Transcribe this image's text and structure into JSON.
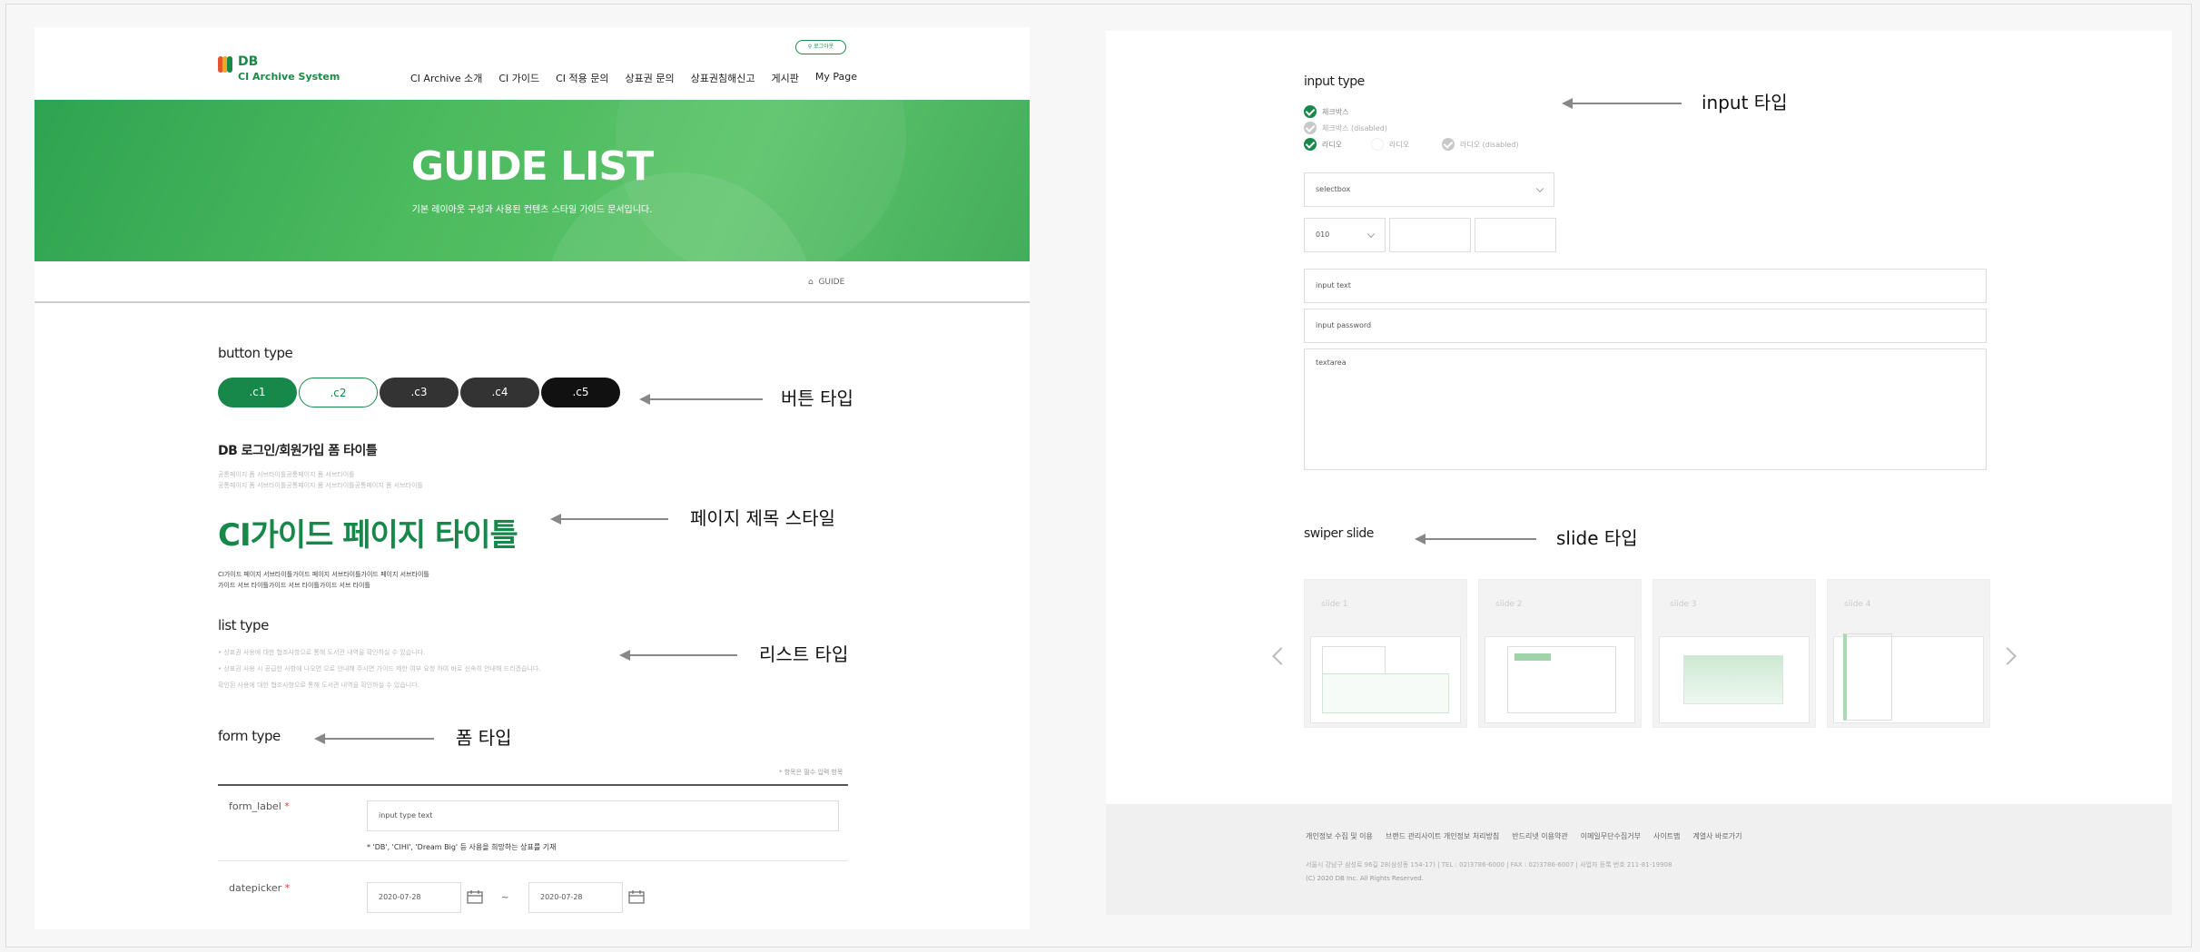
{
  "header": {
    "logo_db": "DB",
    "logo_system": "CI Archive System",
    "login_button": "로그아웃",
    "nav": [
      "CI Archive 소개",
      "CI 가이드",
      "CI 적용 문의",
      "상표권 문의",
      "상표권침해신고",
      "게시판",
      "My Page"
    ]
  },
  "hero": {
    "title": "GUIDE LIST",
    "subtitle": "기본 레이아웃 구성과 사용된 컨텐츠 스타일 가이드 문서입니다."
  },
  "breadcrumb": {
    "current": "GUIDE"
  },
  "button_section": {
    "title": "button type",
    "buttons": [
      ".c1",
      ".c2",
      ".c3",
      ".c4",
      ".c5"
    ]
  },
  "login_form_section": {
    "title": "DB 로그인/회원가입 폼 타이틀",
    "desc1": "공통페이지 폼 서브타이틀공통페이지 폼 서브타이틀",
    "desc2": "공통페이지 폼 서브타이틀공통페이지 폼 서브타이틀공통페이지 폼 서브타이틀"
  },
  "page_title_section": {
    "title": "CI가이드 페이지 타이틀",
    "desc1": "CI가이드 페이지 서브타이틀가이드 페이지 서브타이틀가이드 페이지 서브타이틀",
    "desc2": "가이드 서브 타이틀가이드 서브 타이틀가이드 서브 타이틀"
  },
  "list_section": {
    "title": "list type",
    "items": [
      "• 상표권 사용에 대한 협조사항으로 통해 도서관 내역을 확인하실 수 있습니다.",
      "• 상표권 사용 시 공급한 사항에 나오면 으로 안내해 주시면 가이드 제한 여부 요청 하여 바로 신속히 안내해 드리겠습니다.",
      "확인된 사용에 대한 협조사항으로 통해 도서관 내역을 확인하실 수 있습니다."
    ]
  },
  "form_section": {
    "title": "form type",
    "required_note": "* 항목은 필수 입력 항목",
    "form_label": "form_label",
    "form_label_required": "*",
    "input_placeholder": "input type text",
    "input_note": "* 'DB', 'CIHI', 'Dream Big' 등 사용을 희망하는 상표를 기재",
    "datepicker_label": "datepicker",
    "date_from": "2020-07-28",
    "date_to": "2020-07-28",
    "tilde": "~"
  },
  "annotations": {
    "button": "버튼 타입",
    "page_title": "페이지 제목 스타일",
    "list": "리스트 타입",
    "form": "폼 타입",
    "input": "input 타입",
    "slide": "slide 타입"
  },
  "input_section": {
    "title": "input type",
    "checkbox1": "체크박스",
    "checkbox2": "체크박스 (disabled)",
    "radio1": "라디오",
    "radio2": "라디오",
    "radio3": "라디오 (disabled)",
    "selectbox": "selectbox",
    "phone_prefix": "010",
    "input_text": "input text",
    "input_password": "input password",
    "textarea": "textarea"
  },
  "slide_section": {
    "title": "swiper slide",
    "slides": [
      "slide 1",
      "slide 2",
      "slide 3",
      "slide 4"
    ]
  },
  "footer": {
    "links": [
      "개인정보 수집 및 이용",
      "브랜드 관리사이트 개인정보 처리방침",
      "반드리넷 이용약관",
      "이메일무단수집거부",
      "사이트맵",
      "계열사 바로가기"
    ],
    "address": "서울시 강남구 삼성로 96길 28(삼성동 154-17)  |  TEL : 02)3786-6000  |  FAX : 02)3786-6007  |  사업자 등록 번호 211-81-19908",
    "copyright": "(C) 2020 DB Inc. All Rights Reserved."
  },
  "colors": {
    "brand_green": "#18874a",
    "hero_green": "#44b05c"
  }
}
